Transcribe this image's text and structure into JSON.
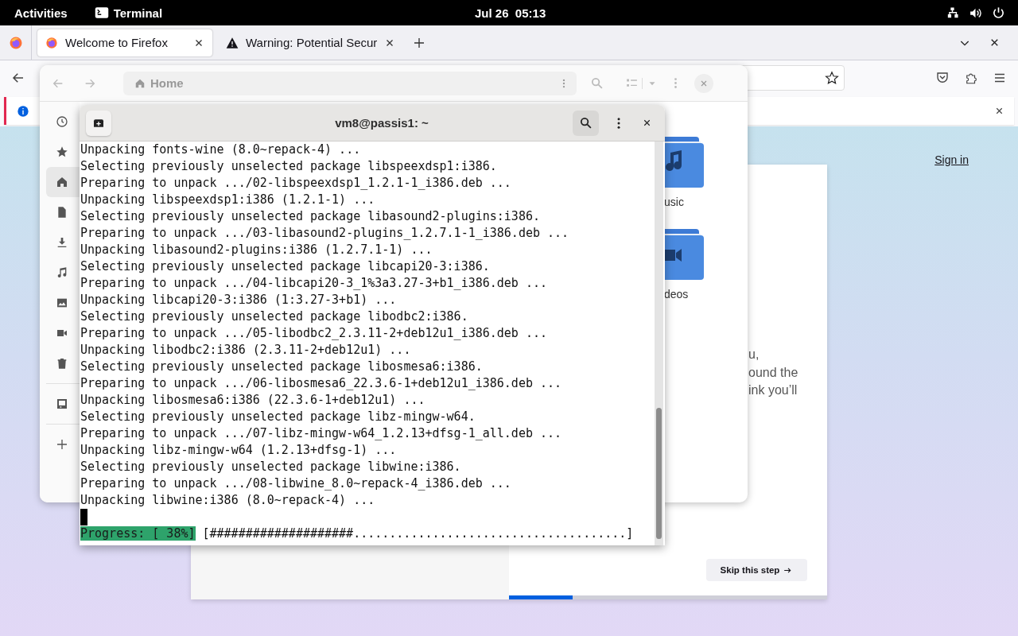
{
  "top_bar": {
    "activities": "Activities",
    "app": "Terminal",
    "clock": "Jul 26  05:13"
  },
  "firefox": {
    "tabs": [
      {
        "title": "Welcome to Firefox",
        "kind": "firefox",
        "selected": true
      },
      {
        "title": "Warning: Potential Secur",
        "kind": "warning",
        "selected": false
      }
    ],
    "notification": {
      "kind": "info"
    },
    "page": {
      "sign_in": "Sign in",
      "text_lines": [
        "u,",
        "ound the",
        "ink you’ll"
      ],
      "skip_button": "Skip this step",
      "progress": {
        "level": 0.2
      }
    }
  },
  "files": {
    "path": "Home",
    "sidebar": [
      {
        "kind": "recent",
        "selected": false
      },
      {
        "kind": "starred",
        "selected": false
      },
      {
        "kind": "home",
        "selected": true
      },
      {
        "kind": "documents",
        "selected": false
      },
      {
        "kind": "downloads",
        "selected": false
      },
      {
        "kind": "music",
        "selected": false
      },
      {
        "kind": "pictures",
        "selected": false
      },
      {
        "kind": "videos",
        "selected": false
      },
      {
        "kind": "trash",
        "selected": false
      }
    ],
    "sidebar_devices": [
      {
        "kind": "drive",
        "selected": false
      }
    ],
    "sidebar_other": [
      {
        "kind": "other",
        "selected": false
      }
    ],
    "folders": [
      {
        "label": "usic",
        "kind": "music"
      },
      {
        "label": "deos",
        "kind": "videos"
      }
    ]
  },
  "terminal": {
    "title": "vm8@passis1: ~",
    "lines": [
      "Unpacking fonts-wine (8.0~repack-4) ...",
      "Selecting previously unselected package libspeexdsp1:i386.",
      "Preparing to unpack .../02-libspeexdsp1_1.2.1-1_i386.deb ...",
      "Unpacking libspeexdsp1:i386 (1.2.1-1) ...",
      "Selecting previously unselected package libasound2-plugins:i386.",
      "Preparing to unpack .../03-libasound2-plugins_1.2.7.1-1_i386.deb ...",
      "Unpacking libasound2-plugins:i386 (1.2.7.1-1) ...",
      "Selecting previously unselected package libcapi20-3:i386.",
      "Preparing to unpack .../04-libcapi20-3_1%3a3.27-3+b1_i386.deb ...",
      "Unpacking libcapi20-3:i386 (1:3.27-3+b1) ...",
      "Selecting previously unselected package libodbc2:i386.",
      "Preparing to unpack .../05-libodbc2_2.3.11-2+deb12u1_i386.deb ...",
      "Unpacking libodbc2:i386 (2.3.11-2+deb12u1) ...",
      "Selecting previously unselected package libosmesa6:i386.",
      "Preparing to unpack .../06-libosmesa6_22.3.6-1+deb12u1_i386.deb ...",
      "Unpacking libosmesa6:i386 (22.3.6-1+deb12u1) ...",
      "Selecting previously unselected package libz-mingw-w64.",
      "Preparing to unpack .../07-libz-mingw-w64_1.2.13+dfsg-1_all.deb ...",
      "Unpacking libz-mingw-w64 (1.2.13+dfsg-1) ...",
      "Selecting previously unselected package libwine:i386.",
      "Preparing to unpack .../08-libwine_8.0~repack-4_i386.deb ...",
      "Unpacking libwine:i386 (8.0~repack-4) ..."
    ],
    "progress_label": "Progress: [ 38%]",
    "progress_bar": "[####################......................................]"
  }
}
